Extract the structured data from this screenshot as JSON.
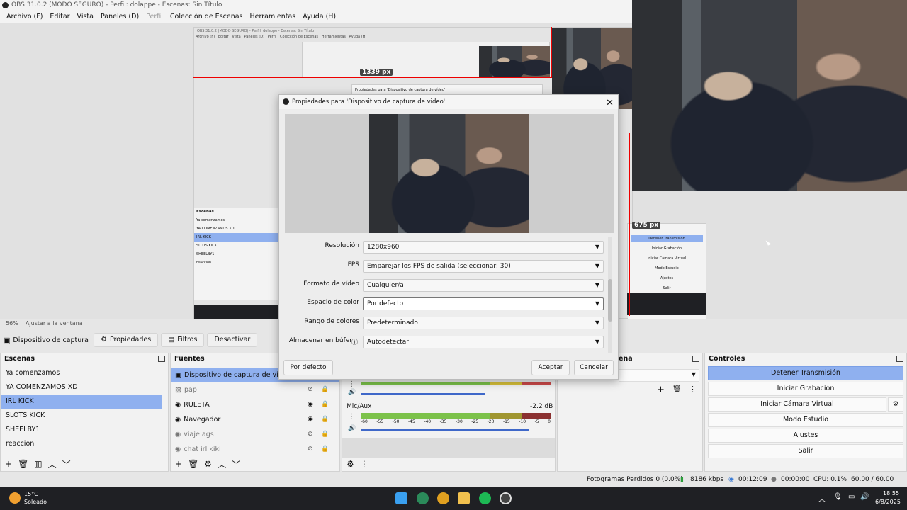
{
  "window": {
    "title": "OBS 31.0.2 (MODO SEGURO) - Perfil: dolappe - Escenas: Sin Título"
  },
  "menu": [
    "Archivo (F)",
    "Editar",
    "Vista",
    "Paneles (D)",
    "Perfil",
    "Colección de Escenas",
    "Herramientas",
    "Ayuda (H)"
  ],
  "preview": {
    "zoom": "56%",
    "fit_label": "Ajustar a la ventana",
    "measure_top": "1339 px",
    "measure_right": "675 px",
    "nested_dialog_title": "Propiedades para 'Dispositivo de captura de vídeo'"
  },
  "source_toolbar": {
    "source_name": "Dispositivo de captura de v",
    "properties": "Propiedades",
    "filters": "Filtros",
    "deactivate": "Desactivar"
  },
  "scenes": {
    "title": "Escenas",
    "items": [
      "Ya comenzamos",
      "YA COMENZAMOS XD",
      "IRL KICK",
      "SLOTS KICK",
      "SHEELBY1",
      "reaccion"
    ],
    "selected_index": 2
  },
  "sources": {
    "title": "Fuentes",
    "items": [
      "Dispositivo de captura de video",
      "pap",
      "RULETA",
      "Navegador",
      "viaje ags",
      "chat irl kiki"
    ]
  },
  "mixer": {
    "track2_name": "Mic/Aux",
    "track2_db": "-2.2 dB",
    "scale": [
      "-60",
      "-55",
      "-50",
      "-45",
      "-40",
      "-35",
      "-30",
      "-25",
      "-20",
      "-15",
      "-10",
      "-5",
      "0"
    ]
  },
  "transitions": {
    "title_fragment": "ena"
  },
  "controls": {
    "title": "Controles",
    "buttons": [
      "Detener Transmisión",
      "Iniciar Grabación",
      "Iniciar Cámara Virtual",
      "Modo Estudio",
      "Ajustes",
      "Salir"
    ]
  },
  "dialog": {
    "title": "Propiedades para 'Dispositivo de captura de video'",
    "fields": [
      {
        "label": "Resolución",
        "value": "1280x960"
      },
      {
        "label": "FPS",
        "value": "Emparejar los FPS de salida (seleccionar: 30)"
      },
      {
        "label": "Formato de vídeo",
        "value": "Cualquier/a"
      },
      {
        "label": "Espacio de color",
        "value": "Por defecto"
      },
      {
        "label": "Rango de colores",
        "value": "Predeterminado"
      },
      {
        "label": "Almacenar en búfer",
        "value": "Autodetectar"
      }
    ],
    "defaults_button": "Por defecto",
    "accept_button": "Aceptar",
    "cancel_button": "Cancelar"
  },
  "statusbar": {
    "dropped": "Fotogramas Perdidos 0 (0.0%)",
    "bitrate": "8186 kbps",
    "stream_time": "00:12:09",
    "rec_time": "00:00:00",
    "cpu": "CPU: 0.1%",
    "fps": "60.00 / 60.00 FPS"
  },
  "taskbar": {
    "temp": "15°C",
    "weather": "Soleado",
    "time": "18:55",
    "date": "6/8/2025"
  },
  "nested": {
    "scenes_title": "Escenas",
    "scenes": [
      "Ya comenzamos",
      "YA COMENZAMOS XD",
      "IRL KICK",
      "SLOTS KICK",
      "SHEELBY1",
      "reaccion"
    ],
    "controls": [
      "Detener Transmisión",
      "Iniciar Grabación",
      "Iniciar Cámara Virtual",
      "Modo Estudio",
      "Ajustes",
      "Salir"
    ]
  }
}
